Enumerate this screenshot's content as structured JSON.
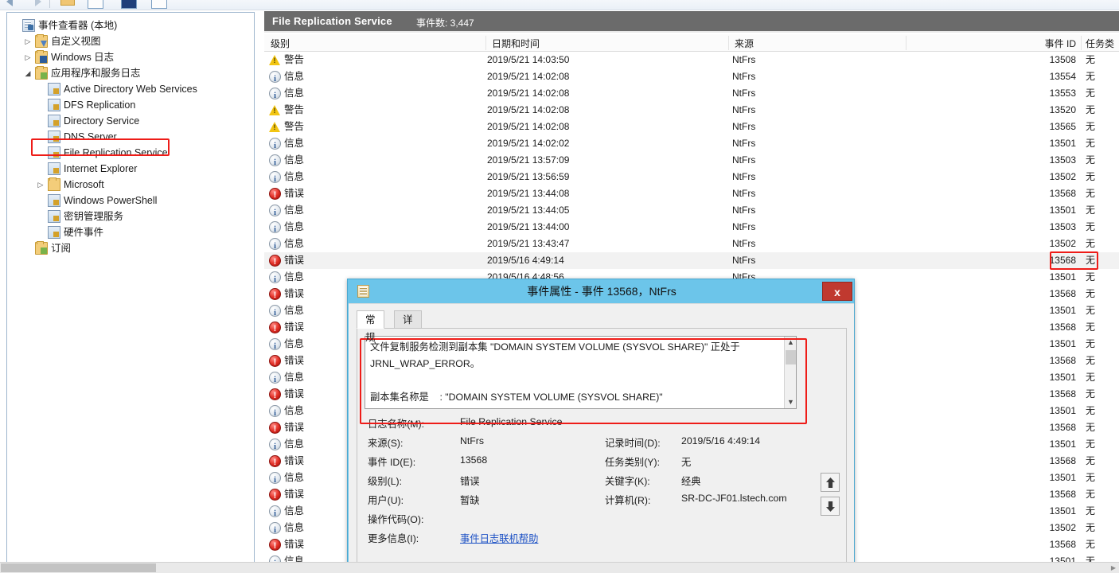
{
  "toolbar": {
    "icons": [
      "back-arrow-icon",
      "forward-arrow-icon",
      "separator",
      "folder-icon",
      "properties-icon",
      "filter-icon",
      "help-icon"
    ]
  },
  "tree": {
    "root": {
      "label": "事件查看器 (本地)",
      "icon": "event-viewer-icon"
    },
    "items": [
      {
        "label": "自定义视图",
        "icon": "folder-custom-views-icon",
        "indent": 1,
        "twisty": "▷",
        "type": "folder"
      },
      {
        "label": "Windows 日志",
        "icon": "folder-windows-logs-icon",
        "indent": 1,
        "twisty": "▷",
        "type": "folder"
      },
      {
        "label": "应用程序和服务日志",
        "icon": "folder-app-service-logs-icon",
        "indent": 1,
        "twisty": "◢",
        "type": "folder"
      },
      {
        "label": "Active Directory Web Services",
        "icon": "log-icon",
        "indent": 2,
        "twisty": "",
        "type": "log"
      },
      {
        "label": "DFS Replication",
        "icon": "log-icon",
        "indent": 2,
        "twisty": "",
        "type": "log"
      },
      {
        "label": "Directory Service",
        "icon": "log-icon",
        "indent": 2,
        "twisty": "",
        "type": "log"
      },
      {
        "label": "DNS Server",
        "icon": "log-icon",
        "indent": 2,
        "twisty": "",
        "type": "log"
      },
      {
        "label": "File Replication Service",
        "icon": "log-icon",
        "indent": 2,
        "twisty": "",
        "type": "log",
        "highlighted": true,
        "selected": true
      },
      {
        "label": "Internet Explorer",
        "icon": "log-icon",
        "indent": 2,
        "twisty": "",
        "type": "log"
      },
      {
        "label": "Microsoft",
        "icon": "plain-folder-icon",
        "indent": 2,
        "twisty": "▷",
        "type": "plainfolder"
      },
      {
        "label": "Windows PowerShell",
        "icon": "log-icon",
        "indent": 2,
        "twisty": "",
        "type": "log"
      },
      {
        "label": "密钥管理服务",
        "icon": "log-icon",
        "indent": 2,
        "twisty": "",
        "type": "log"
      },
      {
        "label": "硬件事件",
        "icon": "log-icon",
        "indent": 2,
        "twisty": "",
        "type": "log"
      },
      {
        "label": "订阅",
        "icon": "folder-subscriptions-icon",
        "indent": 1,
        "twisty": "",
        "type": "folder"
      }
    ]
  },
  "list": {
    "title": "File Replication Service",
    "count_label": "事件数: 3,447",
    "columns": [
      {
        "label": "级别"
      },
      {
        "label": "日期和时间"
      },
      {
        "label": "来源"
      },
      {
        "label": "事件 ID"
      },
      {
        "label": "任务类"
      }
    ],
    "rows": [
      {
        "level": "警告",
        "sev": "warn",
        "datetime": "2019/5/21 14:03:50",
        "source": "NtFrs",
        "event_id": "13508",
        "task": "无"
      },
      {
        "level": "信息",
        "sev": "info",
        "datetime": "2019/5/21 14:02:08",
        "source": "NtFrs",
        "event_id": "13554",
        "task": "无"
      },
      {
        "level": "信息",
        "sev": "info",
        "datetime": "2019/5/21 14:02:08",
        "source": "NtFrs",
        "event_id": "13553",
        "task": "无"
      },
      {
        "level": "警告",
        "sev": "warn",
        "datetime": "2019/5/21 14:02:08",
        "source": "NtFrs",
        "event_id": "13520",
        "task": "无"
      },
      {
        "level": "警告",
        "sev": "warn",
        "datetime": "2019/5/21 14:02:08",
        "source": "NtFrs",
        "event_id": "13565",
        "task": "无"
      },
      {
        "level": "信息",
        "sev": "info",
        "datetime": "2019/5/21 14:02:02",
        "source": "NtFrs",
        "event_id": "13501",
        "task": "无"
      },
      {
        "level": "信息",
        "sev": "info",
        "datetime": "2019/5/21 13:57:09",
        "source": "NtFrs",
        "event_id": "13503",
        "task": "无"
      },
      {
        "level": "信息",
        "sev": "info",
        "datetime": "2019/5/21 13:56:59",
        "source": "NtFrs",
        "event_id": "13502",
        "task": "无"
      },
      {
        "level": "错误",
        "sev": "err",
        "datetime": "2019/5/21 13:44:08",
        "source": "NtFrs",
        "event_id": "13568",
        "task": "无"
      },
      {
        "level": "信息",
        "sev": "info",
        "datetime": "2019/5/21 13:44:05",
        "source": "NtFrs",
        "event_id": "13501",
        "task": "无"
      },
      {
        "level": "信息",
        "sev": "info",
        "datetime": "2019/5/21 13:44:00",
        "source": "NtFrs",
        "event_id": "13503",
        "task": "无"
      },
      {
        "level": "信息",
        "sev": "info",
        "datetime": "2019/5/21 13:43:47",
        "source": "NtFrs",
        "event_id": "13502",
        "task": "无"
      },
      {
        "level": "错误",
        "sev": "err",
        "datetime": "2019/5/16 4:49:14",
        "source": "NtFrs",
        "event_id": "13568",
        "task": "无",
        "selected": true,
        "highlighted_id": true
      },
      {
        "level": "信息",
        "sev": "info",
        "datetime": "2019/5/16 4:48:56",
        "source": "NtFrs",
        "event_id": "13501",
        "task": "无"
      },
      {
        "level": "错误",
        "sev": "err",
        "datetime": "",
        "source": "",
        "event_id": "13568",
        "task": "无"
      },
      {
        "level": "信息",
        "sev": "info",
        "datetime": "",
        "source": "",
        "event_id": "13501",
        "task": "无"
      },
      {
        "level": "错误",
        "sev": "err",
        "datetime": "",
        "source": "",
        "event_id": "13568",
        "task": "无"
      },
      {
        "level": "信息",
        "sev": "info",
        "datetime": "",
        "source": "",
        "event_id": "13501",
        "task": "无"
      },
      {
        "level": "错误",
        "sev": "err",
        "datetime": "",
        "source": "",
        "event_id": "13568",
        "task": "无"
      },
      {
        "level": "信息",
        "sev": "info",
        "datetime": "",
        "source": "",
        "event_id": "13501",
        "task": "无"
      },
      {
        "level": "错误",
        "sev": "err",
        "datetime": "",
        "source": "",
        "event_id": "13568",
        "task": "无"
      },
      {
        "level": "信息",
        "sev": "info",
        "datetime": "",
        "source": "",
        "event_id": "13501",
        "task": "无"
      },
      {
        "level": "错误",
        "sev": "err",
        "datetime": "",
        "source": "",
        "event_id": "13568",
        "task": "无"
      },
      {
        "level": "信息",
        "sev": "info",
        "datetime": "",
        "source": "",
        "event_id": "13501",
        "task": "无"
      },
      {
        "level": "错误",
        "sev": "err",
        "datetime": "",
        "source": "",
        "event_id": "13568",
        "task": "无"
      },
      {
        "level": "信息",
        "sev": "info",
        "datetime": "",
        "source": "",
        "event_id": "13501",
        "task": "无"
      },
      {
        "level": "错误",
        "sev": "err",
        "datetime": "",
        "source": "",
        "event_id": "13568",
        "task": "无"
      },
      {
        "level": "信息",
        "sev": "info",
        "datetime": "",
        "source": "",
        "event_id": "13501",
        "task": "无"
      },
      {
        "level": "信息",
        "sev": "info",
        "datetime": "",
        "source": "",
        "event_id": "13502",
        "task": "无"
      },
      {
        "level": "错误",
        "sev": "err",
        "datetime": "",
        "source": "",
        "event_id": "13568",
        "task": "无"
      },
      {
        "level": "信息",
        "sev": "info",
        "datetime": "",
        "source": "",
        "event_id": "13501",
        "task": "无"
      }
    ]
  },
  "dialog": {
    "title": "事件属性 - 事件 13568，NtFrs",
    "close_label": "x",
    "tabs": [
      {
        "label": "常规",
        "active": true
      },
      {
        "label": "详细信息",
        "active": false
      }
    ],
    "message": "文件复制服务检测到副本集 \"DOMAIN SYSTEM VOLUME (SYSVOL SHARE)\" 正处于\nJRNL_WRAP_ERROR。\n\n副本集名称是    : \"DOMAIN SYSTEM VOLUME (SYSVOL SHARE)\"",
    "fields": [
      {
        "label": "日志名称(M):",
        "value": "File Replication Service",
        "label2": "",
        "value2": ""
      },
      {
        "label": "来源(S):",
        "value": "NtFrs",
        "label2": "记录时间(D):",
        "value2": "2019/5/16 4:49:14"
      },
      {
        "label": "事件 ID(E):",
        "value": "13568",
        "label2": "任务类别(Y):",
        "value2": "无"
      },
      {
        "label": "级别(L):",
        "value": "错误",
        "label2": "关键字(K):",
        "value2": "经典"
      },
      {
        "label": "用户(U):",
        "value": "暂缺",
        "label2": "计算机(R):",
        "value2": "SR-DC-JF01.lstech.com"
      },
      {
        "label": "操作代码(O):",
        "value": "",
        "label2": "",
        "value2": ""
      },
      {
        "label": "更多信息(I):",
        "value": "事件日志联机帮助",
        "value_is_link": true,
        "label2": "",
        "value2": ""
      }
    ],
    "nav": {
      "up": "prev-event-button",
      "down": "next-event-button"
    }
  },
  "colors": {
    "accent": "#6cc5ea",
    "highlight": "#ee1c18",
    "header_bg": "#6b6b6b",
    "error": "#e02b22",
    "warn": "#f2c512",
    "info": "#1f4f8f"
  }
}
